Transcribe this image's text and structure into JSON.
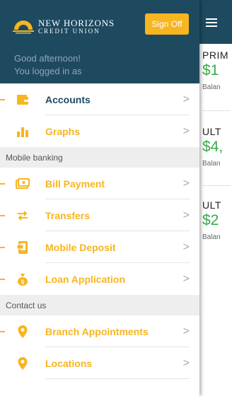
{
  "header": {
    "logo_line1": "NEW HORIZONS",
    "logo_line2": "CREDIT UNION",
    "signoff_label": "Sign Off",
    "greeting_line1": "Good afternoon!",
    "greeting_line2": "You logged in as"
  },
  "menu_primary": [
    {
      "label": "Accounts",
      "icon": "wallet-icon"
    },
    {
      "label": "Graphs",
      "icon": "bar-chart-icon"
    }
  ],
  "section_mobile_banking": "Mobile banking",
  "menu_mobile": [
    {
      "label": "Bill Payment",
      "icon": "bill-icon"
    },
    {
      "label": "Transfers",
      "icon": "transfer-arrows-icon"
    },
    {
      "label": "Mobile Deposit",
      "icon": "check-deposit-icon"
    },
    {
      "label": "Loan Application",
      "icon": "money-bag-icon"
    }
  ],
  "section_contact": "Contact us",
  "menu_contact": [
    {
      "label": "Branch Appointments",
      "icon": "map-pin-icon"
    },
    {
      "label": "Locations",
      "icon": "map-pin-icon"
    }
  ],
  "chevron": ">",
  "accounts_panel": [
    {
      "name": "PRIM",
      "amount": "$1",
      "balance_label": "Balan"
    },
    {
      "name": "ULT",
      "amount": "$4,",
      "balance_label": "Balan"
    },
    {
      "name": "ULT",
      "amount": "$2",
      "balance_label": "Balan"
    }
  ],
  "colors": {
    "brand_navy": "#1e4a60",
    "accent_gold": "#f7b520",
    "amount_green": "#3aa84a"
  }
}
